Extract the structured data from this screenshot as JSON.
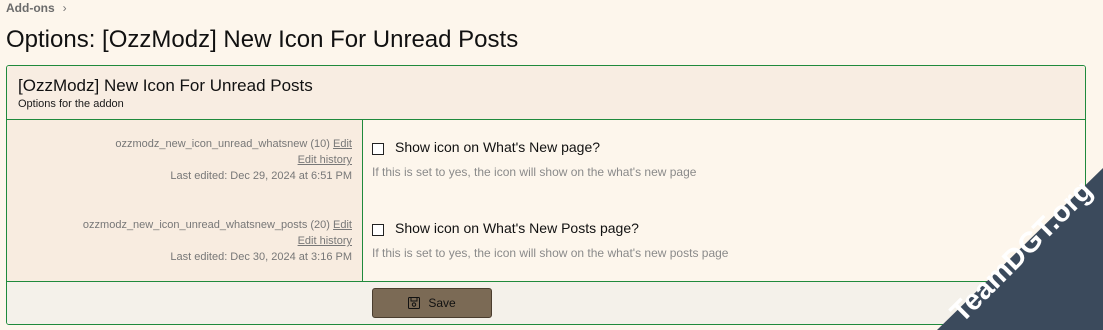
{
  "breadcrumb": {
    "item": "Add-ons"
  },
  "page": {
    "title": "Options: [OzzModz] New Icon For Unread Posts"
  },
  "block": {
    "title": "[OzzModz] New Icon For Unread Posts",
    "description": "Options for the addon"
  },
  "options": [
    {
      "id_text": "ozzmodz_new_icon_unread_whatsnew (10)",
      "edit_label": "Edit",
      "history_label": "Edit history",
      "last_edited": "Last edited: Dec 29, 2024 at 6:51 PM",
      "label": "Show icon on What's New page?",
      "hint": "If this is set to yes, the icon will show on the what's new page",
      "checked": false
    },
    {
      "id_text": "ozzmodz_new_icon_unread_whatsnew_posts (20)",
      "edit_label": "Edit",
      "history_label": "Edit history",
      "last_edited": "Last edited: Dec 30, 2024 at 3:16 PM",
      "label": "Show icon on What's New Posts page?",
      "hint": "If this is set to yes, the icon will show on the what's new posts page",
      "checked": false
    }
  ],
  "footer": {
    "save_label": "Save",
    "save_icon": "save-icon"
  },
  "watermark": {
    "text": "TeamDGT.org",
    "color": "#3b4a5c"
  },
  "colors": {
    "border": "#1f8a3c",
    "button": "#7b6a55"
  }
}
